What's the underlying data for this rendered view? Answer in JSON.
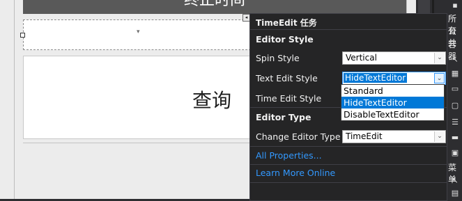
{
  "designer": {
    "header_text": "终止时间",
    "query_button_label": "查询"
  },
  "panel": {
    "title": "TimeEdit 任务",
    "sections": [
      {
        "header": "Editor Style"
      },
      {
        "header": "Editor Type"
      }
    ],
    "spin_style": {
      "label": "Spin Style",
      "value": "Vertical"
    },
    "text_edit_style": {
      "label": "Text Edit Style",
      "value": "HideTextEditor"
    },
    "time_edit_style": {
      "label": "Time Edit Style"
    },
    "change_editor_type": {
      "label": "Change Editor Type",
      "value": "TimeEdit"
    },
    "dropdown_options": [
      "Standard",
      "HideTextEditor",
      "DisableTextEditor"
    ],
    "selected_option_index": 1,
    "all_properties_link": "All Properties...",
    "learn_more_link": "Learn More Online"
  },
  "toolbox": {
    "labels": [
      "所有",
      "公共",
      "容器",
      "菜单"
    ],
    "icons": [
      "pointer-icon",
      "grid-icon",
      "tab-icon",
      "panel-icon",
      "list-icon",
      "bar-icon",
      "pointer-icon",
      "window-icon"
    ]
  },
  "colors": {
    "panel_bg": "#252526",
    "link": "#3399ff",
    "selection": "#0078d7"
  }
}
